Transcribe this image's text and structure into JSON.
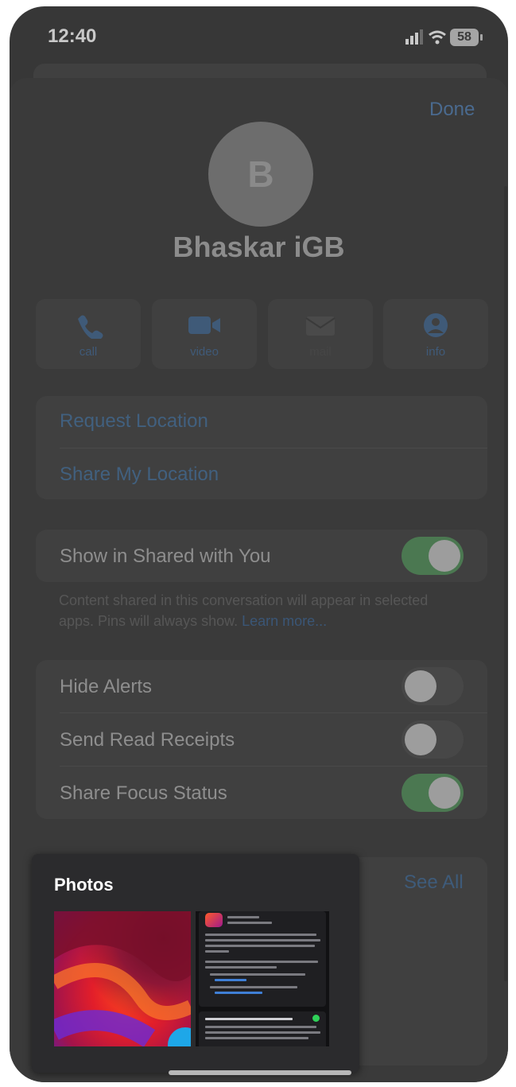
{
  "status_bar": {
    "time": "12:40",
    "battery": "58"
  },
  "header": {
    "done_label": "Done"
  },
  "contact": {
    "avatar_initial": "B",
    "name": "Bhaskar iGB"
  },
  "actions": [
    {
      "label": "call",
      "icon": "phone-icon"
    },
    {
      "label": "video",
      "icon": "video-camera-icon"
    },
    {
      "label": "mail",
      "icon": "mail-icon"
    },
    {
      "label": "info",
      "icon": "person-circle-icon"
    }
  ],
  "location": {
    "request_label": "Request Location",
    "share_label": "Share My Location"
  },
  "shared_with_you": {
    "label": "Show in Shared with You",
    "enabled": true,
    "footnote": "Content shared in this conversation will appear in selected apps. Pins will always show.",
    "learn_more": "Learn more..."
  },
  "settings": [
    {
      "label": "Hide Alerts",
      "enabled": false
    },
    {
      "label": "Send Read Receipts",
      "enabled": false
    },
    {
      "label": "Share Focus Status",
      "enabled": true
    }
  ],
  "photos_section": {
    "see_all_label": "See All"
  },
  "popup": {
    "title": "Photos"
  },
  "colors": {
    "link": "#41607f",
    "toggle_on": "#4b7851",
    "toggle_off": "#474747"
  }
}
